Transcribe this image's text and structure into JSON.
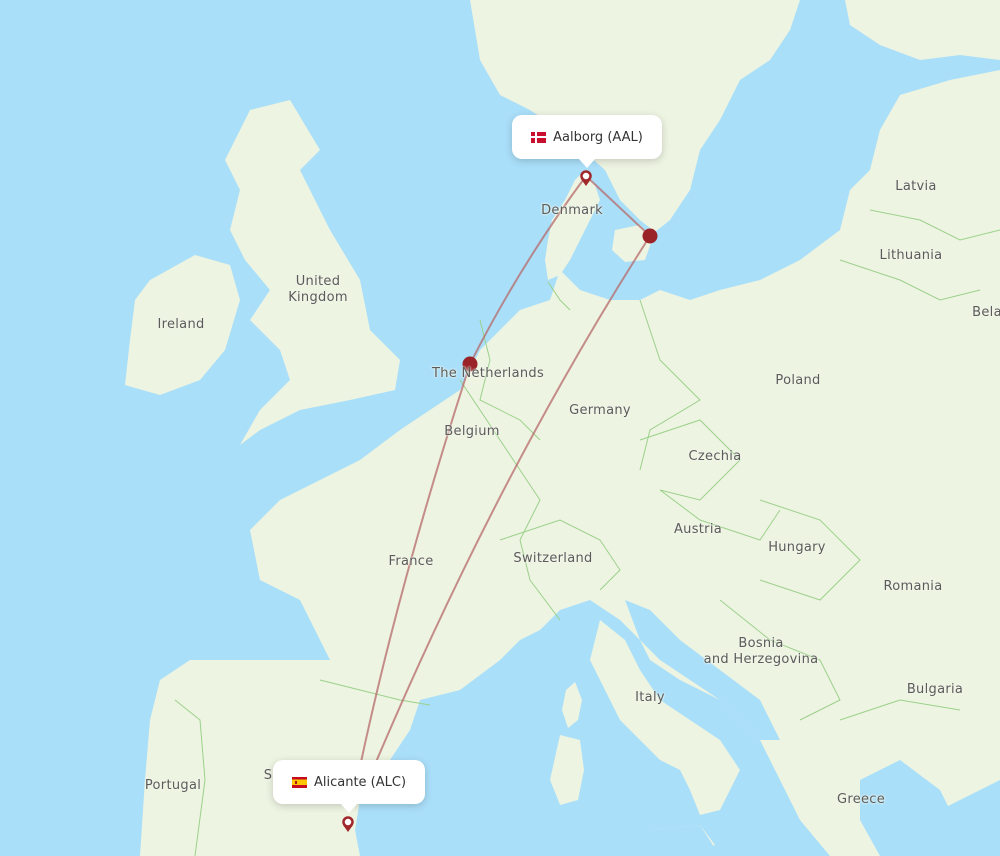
{
  "map": {
    "colors": {
      "water": "#aadff9",
      "land": "#eef4e2",
      "border": "#9bd18b",
      "route": "#b56a6a",
      "marker": "#9a2328"
    },
    "country_labels": [
      {
        "id": "latvia",
        "text": "Latvia"
      },
      {
        "id": "lithuania",
        "text": "Lithuania"
      },
      {
        "id": "belarus",
        "text": "Bela"
      },
      {
        "id": "denmark",
        "text": "Denmark"
      },
      {
        "id": "united-kingdom",
        "text": "United\nKingdom"
      },
      {
        "id": "ireland",
        "text": "Ireland"
      },
      {
        "id": "netherlands",
        "text": "The Netherlands"
      },
      {
        "id": "belgium",
        "text": "Belgium"
      },
      {
        "id": "germany",
        "text": "Germany"
      },
      {
        "id": "poland",
        "text": "Poland"
      },
      {
        "id": "czechia",
        "text": "Czechia"
      },
      {
        "id": "austria",
        "text": "Austria"
      },
      {
        "id": "hungary",
        "text": "Hungary"
      },
      {
        "id": "switzerland",
        "text": "Switzerland"
      },
      {
        "id": "france",
        "text": "France"
      },
      {
        "id": "romania",
        "text": "Romania"
      },
      {
        "id": "bosnia",
        "text": "Bosnia\nand Herzegovina"
      },
      {
        "id": "bulgaria",
        "text": "Bulgaria"
      },
      {
        "id": "italy",
        "text": "Italy"
      },
      {
        "id": "greece",
        "text": "Greece"
      },
      {
        "id": "portugal",
        "text": "Portugal"
      },
      {
        "id": "spain",
        "text": "S"
      }
    ],
    "origin": {
      "name": "Aalborg (AAL)",
      "country_flag": "denmark-flag"
    },
    "destination": {
      "name": "Alicante (ALC)",
      "country_flag": "spain-flag"
    },
    "routes": [
      {
        "from": "AAL",
        "via": "Amsterdam",
        "to": "ALC"
      },
      {
        "from": "AAL",
        "via": "Copenhagen",
        "to": "ALC"
      }
    ]
  }
}
